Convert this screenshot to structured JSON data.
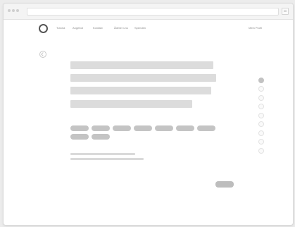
{
  "window": {
    "url": "",
    "traffic_lights": [
      "close",
      "minimize",
      "zoom"
    ]
  },
  "nav": {
    "links": [
      {
        "label": "Tutoria"
      },
      {
        "label": "Angebot"
      },
      {
        "label": "Kontakt"
      },
      {
        "label": "Ãœber uns"
      },
      {
        "label": "Spenden"
      }
    ],
    "right_link": "Mein Profil"
  },
  "question": {
    "lines": 4
  },
  "answers": {
    "count": 9
  },
  "footer_lines": 2,
  "progress": {
    "total_steps": 9,
    "current_step": 1
  }
}
